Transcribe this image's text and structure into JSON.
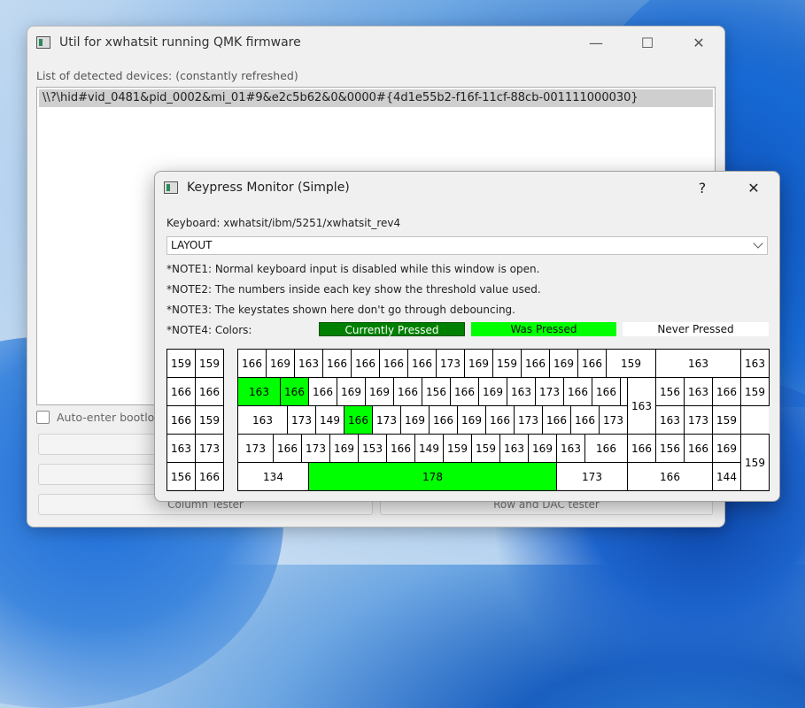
{
  "main_window": {
    "title": "Util for xwhatsit running QMK firmware",
    "devices_label": "List of detected devices: (constantly refreshed)",
    "devices": [
      "\\\\?\\hid#vid_0481&pid_0002&mi_01#9&e2c5b62&0&0000#{4d1e55b2-f16f-11cf-88cb-001111000030}"
    ],
    "auto_enter_label": "Auto-enter bootloa",
    "column_tester_label": "Column Tester",
    "row_dac_tester_label": "Row and DAC tester"
  },
  "dialog": {
    "title": "Keypress Monitor (Simple)",
    "help_glyph": "?",
    "close_glyph": "✕",
    "keyboard_label": "Keyboard: xwhatsit/ibm/5251/xwhatsit_rev4",
    "layout_select": "LAYOUT",
    "notes": [
      "*NOTE1: Normal keyboard input is disabled while this window is open.",
      "*NOTE2: The numbers inside each key show the threshold value used.",
      "*NOTE3: The keystates shown here don't go through debouncing.",
      "*NOTE4: Colors:"
    ],
    "legend": {
      "current": "Currently Pressed",
      "was": "Was Pressed",
      "never": "Never Pressed"
    },
    "colors": {
      "current": "#008000",
      "was": "#00ff00",
      "never": "#ffffff"
    }
  },
  "left_block": [
    [
      "159",
      "159"
    ],
    [
      "166",
      "166"
    ],
    [
      "166",
      "159"
    ],
    [
      "163",
      "173"
    ],
    [
      "156",
      "166"
    ]
  ],
  "main_keys": [
    {
      "label": "166",
      "state": "never"
    },
    {
      "label": "169",
      "state": "never"
    },
    {
      "label": "163",
      "state": "never"
    },
    {
      "label": "166",
      "state": "never"
    },
    {
      "label": "166",
      "state": "never"
    },
    {
      "label": "166",
      "state": "never"
    },
    {
      "label": "166",
      "state": "never"
    },
    {
      "label": "173",
      "state": "never"
    },
    {
      "label": "169",
      "state": "never"
    },
    {
      "label": "159",
      "state": "never"
    },
    {
      "label": "166",
      "state": "never"
    },
    {
      "label": "169",
      "state": "never"
    },
    {
      "label": "166",
      "state": "never"
    },
    {
      "label": "159",
      "state": "never"
    },
    {
      "label": "163",
      "state": "never"
    },
    {
      "label": "163",
      "state": "never"
    },
    {
      "label": "163",
      "state": "was"
    },
    {
      "label": "166",
      "state": "was"
    },
    {
      "label": "166",
      "state": "never"
    },
    {
      "label": "169",
      "state": "never"
    },
    {
      "label": "169",
      "state": "never"
    },
    {
      "label": "166",
      "state": "never"
    },
    {
      "label": "156",
      "state": "never"
    },
    {
      "label": "166",
      "state": "never"
    },
    {
      "label": "169",
      "state": "never"
    },
    {
      "label": "163",
      "state": "never"
    },
    {
      "label": "173",
      "state": "never"
    },
    {
      "label": "166",
      "state": "never"
    },
    {
      "label": "166",
      "state": "never"
    },
    {
      "label": "163",
      "state": "never"
    },
    {
      "label": "156",
      "state": "never"
    },
    {
      "label": "163",
      "state": "never"
    },
    {
      "label": "166",
      "state": "never"
    },
    {
      "label": "159",
      "state": "never"
    },
    {
      "label": "163",
      "state": "never"
    },
    {
      "label": "173",
      "state": "never"
    },
    {
      "label": "149",
      "state": "never"
    },
    {
      "label": "166",
      "state": "was"
    },
    {
      "label": "173",
      "state": "never"
    },
    {
      "label": "169",
      "state": "never"
    },
    {
      "label": "166",
      "state": "never"
    },
    {
      "label": "169",
      "state": "never"
    },
    {
      "label": "166",
      "state": "never"
    },
    {
      "label": "173",
      "state": "never"
    },
    {
      "label": "166",
      "state": "never"
    },
    {
      "label": "166",
      "state": "never"
    },
    {
      "label": "173",
      "state": "never"
    },
    {
      "label": "163",
      "state": "never"
    },
    {
      "label": "173",
      "state": "never"
    },
    {
      "label": "159",
      "state": "never"
    },
    {
      "label": "173",
      "state": "never"
    },
    {
      "label": "166",
      "state": "never"
    },
    {
      "label": "173",
      "state": "never"
    },
    {
      "label": "169",
      "state": "never"
    },
    {
      "label": "153",
      "state": "never"
    },
    {
      "label": "166",
      "state": "never"
    },
    {
      "label": "149",
      "state": "never"
    },
    {
      "label": "159",
      "state": "never"
    },
    {
      "label": "159",
      "state": "never"
    },
    {
      "label": "163",
      "state": "never"
    },
    {
      "label": "169",
      "state": "never"
    },
    {
      "label": "163",
      "state": "never"
    },
    {
      "label": "166",
      "state": "never"
    },
    {
      "label": "166",
      "state": "never"
    },
    {
      "label": "156",
      "state": "never"
    },
    {
      "label": "166",
      "state": "never"
    },
    {
      "label": "169",
      "state": "never"
    },
    {
      "label": "159",
      "state": "never"
    },
    {
      "label": "134",
      "state": "never"
    },
    {
      "label": "178",
      "state": "was"
    },
    {
      "label": "173",
      "state": "never"
    },
    {
      "label": "166",
      "state": "never"
    },
    {
      "label": "144",
      "state": "never"
    }
  ]
}
